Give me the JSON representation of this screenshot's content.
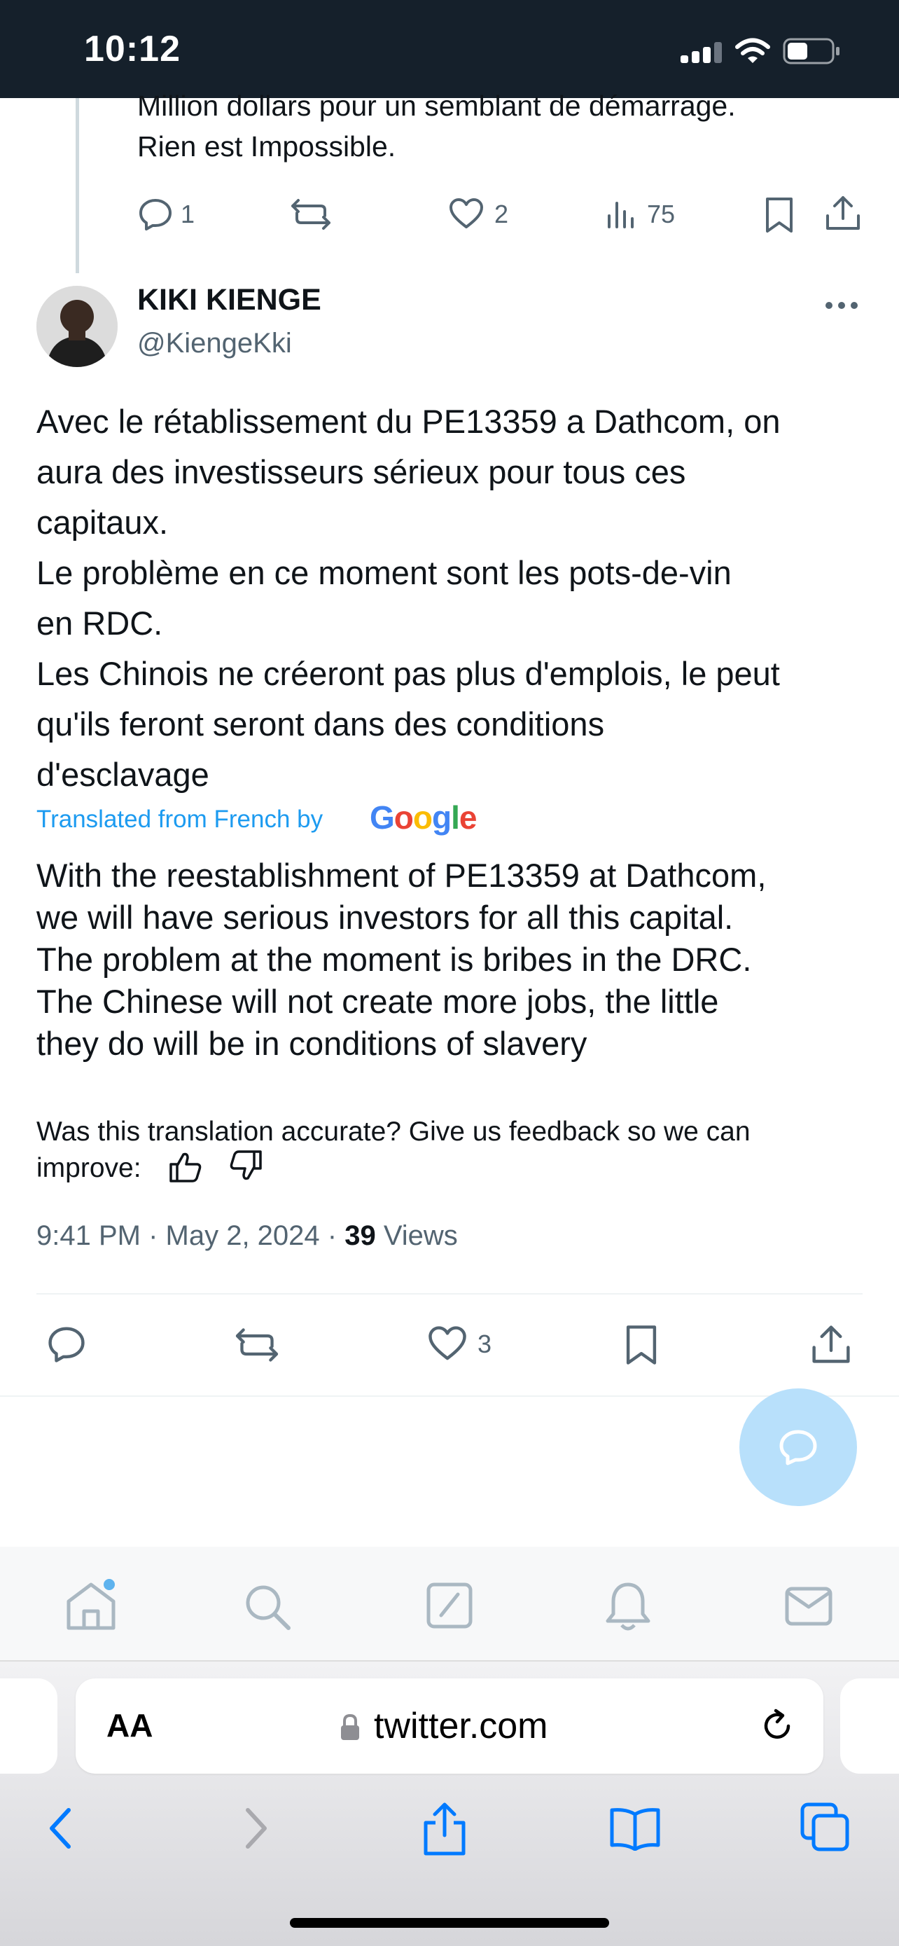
{
  "status_bar": {
    "time": "10:12",
    "icons": [
      "cellular-signal-icon",
      "wifi-icon",
      "battery-icon"
    ]
  },
  "previous_tweet": {
    "text_lines": [
      "Million dollars pour un semblant de démarrage.",
      "Rien est Impossible."
    ],
    "actions": {
      "replies": "1",
      "retweets": "",
      "likes": "2",
      "views": "75"
    }
  },
  "tweet": {
    "author_name": "KIKI KIENGE",
    "author_handle": "@KiengeKki",
    "original_lines": [
      "Avec le rétablissement du PE13359 a Dathcom, on",
      "aura des investisseurs sérieux pour tous ces",
      "capitaux.",
      "Le problème en ce moment sont les pots-de-vin",
      "en RDC.",
      "Les Chinois ne créeront pas plus d'emplois, le peut",
      "qu'ils feront seront dans des conditions",
      "d'esclavage"
    ],
    "translated_label": "Translated from French by",
    "translation_provider": "Google",
    "translation_lines": [
      "With the reestablishment of PE13359 at Dathcom,",
      "we will have serious investors for all this capital.",
      "The problem at the moment is bribes in the DRC.",
      "The Chinese will not create more jobs, the little",
      "they do will be in conditions of slavery"
    ],
    "feedback_lines": [
      "Was this translation accurate? Give us feedback so we can",
      "improve:"
    ],
    "timestamp": "9:41 PM · May 2, 2024 · ",
    "views_count": "39",
    "views_label": " Views",
    "actions": {
      "likes": "3"
    }
  },
  "bottom_nav": [
    "home-icon",
    "search-icon",
    "compose-icon",
    "notifications-icon",
    "messages-icon"
  ],
  "browser": {
    "text_size_label": "AA",
    "url": "twitter.com"
  },
  "colors": {
    "accent": "#1d9bf0",
    "muted_text": "#536471",
    "status_bar_bg": "#15202b",
    "fab_bg": "#b8e0fb",
    "safari_blue": "#007aff"
  }
}
